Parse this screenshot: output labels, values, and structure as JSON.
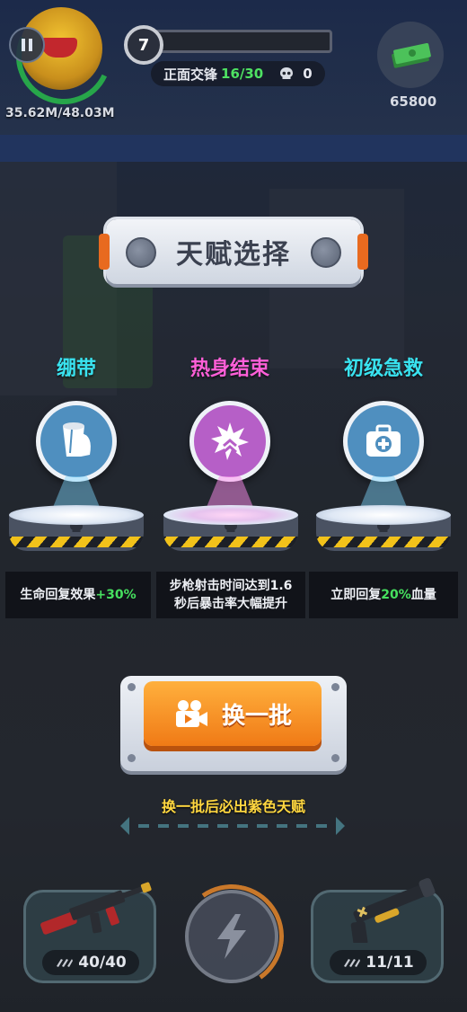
{
  "hud": {
    "pause_icon": "pause-icon",
    "hp_text": "35.62M/48.03M",
    "level": "7",
    "level_progress": 0.06,
    "mission_label": "正面交锋",
    "mission_count": "16/30",
    "kill_count": "0",
    "cash_icon": "cash-stack-icon",
    "cash": "65800"
  },
  "panel": {
    "title": "天赋选择"
  },
  "talents": [
    {
      "name": "绷带",
      "name_color": "#39e3f0",
      "icon": "bandage-roll-icon",
      "icon_bg": "#4f8fbf",
      "desc_pre": "生命回复效果",
      "desc_hl": "+30%",
      "desc_post": ""
    },
    {
      "name": "热身结束",
      "name_color": "#ff5fd8",
      "icon": "crit-burst-icon",
      "icon_bg": "#b65fc7",
      "desc_pre": "步枪射击时间达到1.6秒后暴击率大幅提升",
      "desc_hl": "",
      "desc_post": ""
    },
    {
      "name": "初级急救",
      "name_color": "#39e3f0",
      "icon": "first-aid-kit-icon",
      "icon_bg": "#4f8fbf",
      "desc_pre": "立即回复",
      "desc_hl": "20%",
      "desc_post": "血量"
    }
  ],
  "refresh": {
    "icon": "video-camera-icon",
    "label": "换一批",
    "hint": "换一批后必出紫色天赋"
  },
  "weapons": {
    "primary": {
      "icon": "assault-rifle-icon",
      "ammo": "40/40"
    },
    "skill": {
      "icon": "lightning-icon"
    },
    "secondary": {
      "icon": "shotgun-icon",
      "ammo": "11/11"
    }
  },
  "colors": {
    "accent_orange": "#f07a16",
    "highlight_green": "#46e05f",
    "hint_yellow": "#ffd740"
  }
}
